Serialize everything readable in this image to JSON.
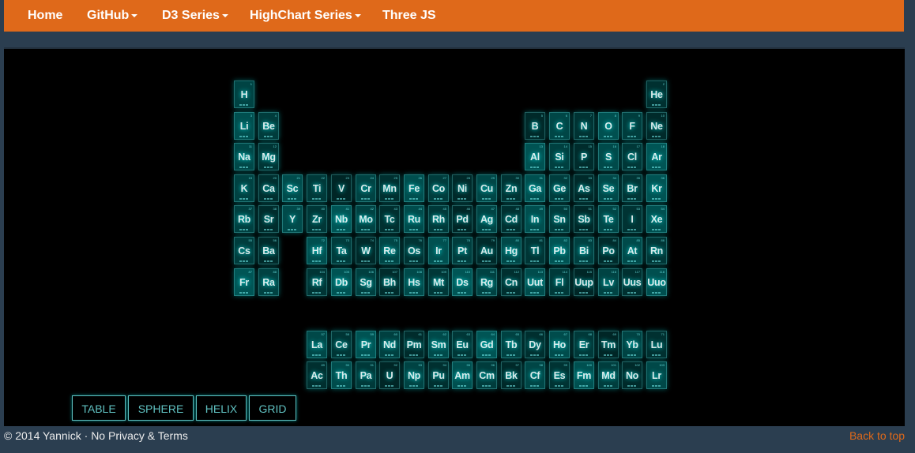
{
  "nav": {
    "items": [
      {
        "label": "Home",
        "dropdown": false
      },
      {
        "label": "GitHub",
        "dropdown": true
      },
      {
        "label": "D3 Series",
        "dropdown": true
      },
      {
        "label": "HighChart Series",
        "dropdown": true
      },
      {
        "label": "Three JS",
        "dropdown": false
      }
    ]
  },
  "colors": {
    "navbar": "#df691a",
    "page_bg": "#2b3e50",
    "stage_bg": "#000000",
    "tile_glow": "#00ffff"
  },
  "periodic_table": {
    "elements": [
      {
        "sym": "H",
        "n": 1,
        "col": 1,
        "row": 1
      },
      {
        "sym": "He",
        "n": 2,
        "col": 18,
        "row": 1
      },
      {
        "sym": "Li",
        "n": 3,
        "col": 1,
        "row": 2
      },
      {
        "sym": "Be",
        "n": 4,
        "col": 2,
        "row": 2
      },
      {
        "sym": "B",
        "n": 5,
        "col": 13,
        "row": 2
      },
      {
        "sym": "C",
        "n": 6,
        "col": 14,
        "row": 2
      },
      {
        "sym": "N",
        "n": 7,
        "col": 15,
        "row": 2
      },
      {
        "sym": "O",
        "n": 8,
        "col": 16,
        "row": 2
      },
      {
        "sym": "F",
        "n": 9,
        "col": 17,
        "row": 2
      },
      {
        "sym": "Ne",
        "n": 10,
        "col": 18,
        "row": 2
      },
      {
        "sym": "Na",
        "n": 11,
        "col": 1,
        "row": 3
      },
      {
        "sym": "Mg",
        "n": 12,
        "col": 2,
        "row": 3
      },
      {
        "sym": "Al",
        "n": 13,
        "col": 13,
        "row": 3
      },
      {
        "sym": "Si",
        "n": 14,
        "col": 14,
        "row": 3
      },
      {
        "sym": "P",
        "n": 15,
        "col": 15,
        "row": 3
      },
      {
        "sym": "S",
        "n": 16,
        "col": 16,
        "row": 3
      },
      {
        "sym": "Cl",
        "n": 17,
        "col": 17,
        "row": 3
      },
      {
        "sym": "Ar",
        "n": 18,
        "col": 18,
        "row": 3
      },
      {
        "sym": "K",
        "n": 19,
        "col": 1,
        "row": 4
      },
      {
        "sym": "Ca",
        "n": 20,
        "col": 2,
        "row": 4
      },
      {
        "sym": "Sc",
        "n": 21,
        "col": 3,
        "row": 4
      },
      {
        "sym": "Ti",
        "n": 22,
        "col": 4,
        "row": 4
      },
      {
        "sym": "V",
        "n": 23,
        "col": 5,
        "row": 4
      },
      {
        "sym": "Cr",
        "n": 24,
        "col": 6,
        "row": 4
      },
      {
        "sym": "Mn",
        "n": 25,
        "col": 7,
        "row": 4
      },
      {
        "sym": "Fe",
        "n": 26,
        "col": 8,
        "row": 4
      },
      {
        "sym": "Co",
        "n": 27,
        "col": 9,
        "row": 4
      },
      {
        "sym": "Ni",
        "n": 28,
        "col": 10,
        "row": 4
      },
      {
        "sym": "Cu",
        "n": 29,
        "col": 11,
        "row": 4
      },
      {
        "sym": "Zn",
        "n": 30,
        "col": 12,
        "row": 4
      },
      {
        "sym": "Ga",
        "n": 31,
        "col": 13,
        "row": 4
      },
      {
        "sym": "Ge",
        "n": 32,
        "col": 14,
        "row": 4
      },
      {
        "sym": "As",
        "n": 33,
        "col": 15,
        "row": 4
      },
      {
        "sym": "Se",
        "n": 34,
        "col": 16,
        "row": 4
      },
      {
        "sym": "Br",
        "n": 35,
        "col": 17,
        "row": 4
      },
      {
        "sym": "Kr",
        "n": 36,
        "col": 18,
        "row": 4
      },
      {
        "sym": "Rb",
        "n": 37,
        "col": 1,
        "row": 5
      },
      {
        "sym": "Sr",
        "n": 38,
        "col": 2,
        "row": 5
      },
      {
        "sym": "Y",
        "n": 39,
        "col": 3,
        "row": 5
      },
      {
        "sym": "Zr",
        "n": 40,
        "col": 4,
        "row": 5
      },
      {
        "sym": "Nb",
        "n": 41,
        "col": 5,
        "row": 5
      },
      {
        "sym": "Mo",
        "n": 42,
        "col": 6,
        "row": 5
      },
      {
        "sym": "Tc",
        "n": 43,
        "col": 7,
        "row": 5
      },
      {
        "sym": "Ru",
        "n": 44,
        "col": 8,
        "row": 5
      },
      {
        "sym": "Rh",
        "n": 45,
        "col": 9,
        "row": 5
      },
      {
        "sym": "Pd",
        "n": 46,
        "col": 10,
        "row": 5
      },
      {
        "sym": "Ag",
        "n": 47,
        "col": 11,
        "row": 5
      },
      {
        "sym": "Cd",
        "n": 48,
        "col": 12,
        "row": 5
      },
      {
        "sym": "In",
        "n": 49,
        "col": 13,
        "row": 5
      },
      {
        "sym": "Sn",
        "n": 50,
        "col": 14,
        "row": 5
      },
      {
        "sym": "Sb",
        "n": 51,
        "col": 15,
        "row": 5
      },
      {
        "sym": "Te",
        "n": 52,
        "col": 16,
        "row": 5
      },
      {
        "sym": "I",
        "n": 53,
        "col": 17,
        "row": 5
      },
      {
        "sym": "Xe",
        "n": 54,
        "col": 18,
        "row": 5
      },
      {
        "sym": "Cs",
        "n": 55,
        "col": 1,
        "row": 6
      },
      {
        "sym": "Ba",
        "n": 56,
        "col": 2,
        "row": 6
      },
      {
        "sym": "Hf",
        "n": 72,
        "col": 4,
        "row": 6
      },
      {
        "sym": "Ta",
        "n": 73,
        "col": 5,
        "row": 6
      },
      {
        "sym": "W",
        "n": 74,
        "col": 6,
        "row": 6
      },
      {
        "sym": "Re",
        "n": 75,
        "col": 7,
        "row": 6
      },
      {
        "sym": "Os",
        "n": 76,
        "col": 8,
        "row": 6
      },
      {
        "sym": "Ir",
        "n": 77,
        "col": 9,
        "row": 6
      },
      {
        "sym": "Pt",
        "n": 78,
        "col": 10,
        "row": 6
      },
      {
        "sym": "Au",
        "n": 79,
        "col": 11,
        "row": 6
      },
      {
        "sym": "Hg",
        "n": 80,
        "col": 12,
        "row": 6
      },
      {
        "sym": "Tl",
        "n": 81,
        "col": 13,
        "row": 6
      },
      {
        "sym": "Pb",
        "n": 82,
        "col": 14,
        "row": 6
      },
      {
        "sym": "Bi",
        "n": 83,
        "col": 15,
        "row": 6
      },
      {
        "sym": "Po",
        "n": 84,
        "col": 16,
        "row": 6
      },
      {
        "sym": "At",
        "n": 85,
        "col": 17,
        "row": 6
      },
      {
        "sym": "Rn",
        "n": 86,
        "col": 18,
        "row": 6
      },
      {
        "sym": "Fr",
        "n": 87,
        "col": 1,
        "row": 7
      },
      {
        "sym": "Ra",
        "n": 88,
        "col": 2,
        "row": 7
      },
      {
        "sym": "Rf",
        "n": 104,
        "col": 4,
        "row": 7
      },
      {
        "sym": "Db",
        "n": 105,
        "col": 5,
        "row": 7
      },
      {
        "sym": "Sg",
        "n": 106,
        "col": 6,
        "row": 7
      },
      {
        "sym": "Bh",
        "n": 107,
        "col": 7,
        "row": 7
      },
      {
        "sym": "Hs",
        "n": 108,
        "col": 8,
        "row": 7
      },
      {
        "sym": "Mt",
        "n": 109,
        "col": 9,
        "row": 7
      },
      {
        "sym": "Ds",
        "n": 110,
        "col": 10,
        "row": 7
      },
      {
        "sym": "Rg",
        "n": 111,
        "col": 11,
        "row": 7
      },
      {
        "sym": "Cn",
        "n": 112,
        "col": 12,
        "row": 7
      },
      {
        "sym": "Uut",
        "n": 113,
        "col": 13,
        "row": 7
      },
      {
        "sym": "Fl",
        "n": 114,
        "col": 14,
        "row": 7
      },
      {
        "sym": "Uup",
        "n": 115,
        "col": 15,
        "row": 7
      },
      {
        "sym": "Lv",
        "n": 116,
        "col": 16,
        "row": 7
      },
      {
        "sym": "Uus",
        "n": 117,
        "col": 17,
        "row": 7
      },
      {
        "sym": "Uuo",
        "n": 118,
        "col": 18,
        "row": 7
      },
      {
        "sym": "La",
        "n": 57,
        "col": 4,
        "row": 9
      },
      {
        "sym": "Ce",
        "n": 58,
        "col": 5,
        "row": 9
      },
      {
        "sym": "Pr",
        "n": 59,
        "col": 6,
        "row": 9
      },
      {
        "sym": "Nd",
        "n": 60,
        "col": 7,
        "row": 9
      },
      {
        "sym": "Pm",
        "n": 61,
        "col": 8,
        "row": 9
      },
      {
        "sym": "Sm",
        "n": 62,
        "col": 9,
        "row": 9
      },
      {
        "sym": "Eu",
        "n": 63,
        "col": 10,
        "row": 9
      },
      {
        "sym": "Gd",
        "n": 64,
        "col": 11,
        "row": 9
      },
      {
        "sym": "Tb",
        "n": 65,
        "col": 12,
        "row": 9
      },
      {
        "sym": "Dy",
        "n": 66,
        "col": 13,
        "row": 9
      },
      {
        "sym": "Ho",
        "n": 67,
        "col": 14,
        "row": 9
      },
      {
        "sym": "Er",
        "n": 68,
        "col": 15,
        "row": 9
      },
      {
        "sym": "Tm",
        "n": 69,
        "col": 16,
        "row": 9
      },
      {
        "sym": "Yb",
        "n": 70,
        "col": 17,
        "row": 9
      },
      {
        "sym": "Lu",
        "n": 71,
        "col": 18,
        "row": 9
      },
      {
        "sym": "Ac",
        "n": 89,
        "col": 4,
        "row": 10
      },
      {
        "sym": "Th",
        "n": 90,
        "col": 5,
        "row": 10
      },
      {
        "sym": "Pa",
        "n": 91,
        "col": 6,
        "row": 10
      },
      {
        "sym": "U",
        "n": 92,
        "col": 7,
        "row": 10
      },
      {
        "sym": "Np",
        "n": 93,
        "col": 8,
        "row": 10
      },
      {
        "sym": "Pu",
        "n": 94,
        "col": 9,
        "row": 10
      },
      {
        "sym": "Am",
        "n": 95,
        "col": 10,
        "row": 10
      },
      {
        "sym": "Cm",
        "n": 96,
        "col": 11,
        "row": 10
      },
      {
        "sym": "Bk",
        "n": 97,
        "col": 12,
        "row": 10
      },
      {
        "sym": "Cf",
        "n": 98,
        "col": 13,
        "row": 10
      },
      {
        "sym": "Es",
        "n": 99,
        "col": 14,
        "row": 10
      },
      {
        "sym": "Fm",
        "n": 100,
        "col": 15,
        "row": 10
      },
      {
        "sym": "Md",
        "n": 101,
        "col": 16,
        "row": 10
      },
      {
        "sym": "No",
        "n": 102,
        "col": 17,
        "row": 10
      },
      {
        "sym": "Lr",
        "n": 103,
        "col": 18,
        "row": 10
      }
    ]
  },
  "menu": {
    "buttons": [
      {
        "label": "TABLE"
      },
      {
        "label": "SPHERE"
      },
      {
        "label": "HELIX"
      },
      {
        "label": "GRID"
      }
    ]
  },
  "footer": {
    "copyright": "© 2014 Yannick · No Privacy & Terms",
    "back_to_top": "Back to top"
  }
}
